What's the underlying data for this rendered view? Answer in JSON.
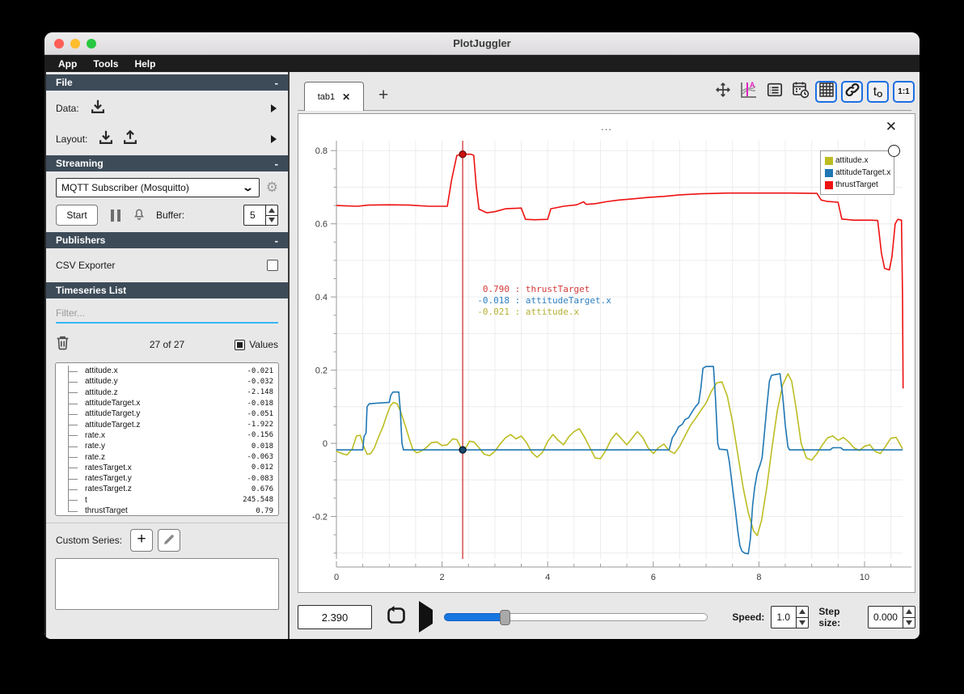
{
  "window": {
    "title": "PlotJuggler"
  },
  "menu": {
    "items": [
      "App",
      "Tools",
      "Help"
    ]
  },
  "sidebar": {
    "file": {
      "title": "File",
      "collapse": "-",
      "data_label": "Data:",
      "layout_label": "Layout:"
    },
    "streaming": {
      "title": "Streaming",
      "collapse": "-",
      "source_selected": "MQTT Subscriber (Mosquitto)",
      "start_label": "Start",
      "buffer_label": "Buffer:",
      "buffer_value": "5"
    },
    "publishers": {
      "title": "Publishers",
      "collapse": "-",
      "csv_label": "CSV Exporter"
    },
    "timeseries": {
      "title": "Timeseries List",
      "filter_placeholder": "Filter...",
      "count": "27 of 27",
      "values_label": "Values",
      "items": [
        {
          "name": "attitude.x",
          "value": "-0.021"
        },
        {
          "name": "attitude.y",
          "value": "-0.032"
        },
        {
          "name": "attitude.z",
          "value": "-2.148"
        },
        {
          "name": "attitudeTarget.x",
          "value": "-0.018"
        },
        {
          "name": "attitudeTarget.y",
          "value": "-0.051"
        },
        {
          "name": "attitudeTarget.z",
          "value": "-1.922"
        },
        {
          "name": "rate.x",
          "value": "-0.156"
        },
        {
          "name": "rate.y",
          "value": "0.018"
        },
        {
          "name": "rate.z",
          "value": "-0.063"
        },
        {
          "name": "ratesTarget.x",
          "value": "0.012"
        },
        {
          "name": "ratesTarget.y",
          "value": "-0.083"
        },
        {
          "name": "ratesTarget.z",
          "value": "0.676"
        },
        {
          "name": "t",
          "value": "245.548"
        },
        {
          "name": "thrustTarget",
          "value": "0.79"
        }
      ]
    },
    "custom_series_label": "Custom Series:",
    "add_label": "+"
  },
  "main": {
    "tabs": [
      {
        "label": "tab1"
      }
    ],
    "new_tab_label": "+",
    "toolbar": {
      "t_label": "t",
      "t_sub": "O",
      "ratio_label": "1:1",
      "buttons": [
        {
          "name": "pan-zoom",
          "active": false
        },
        {
          "name": "curve-tracker",
          "active": false
        },
        {
          "name": "list-view",
          "active": false
        },
        {
          "name": "datetime",
          "active": false
        },
        {
          "name": "grid-view",
          "active": true
        },
        {
          "name": "link-axes",
          "active": true
        },
        {
          "name": "time-offset",
          "active": true
        },
        {
          "name": "ratio-1-1",
          "active": true
        }
      ]
    }
  },
  "plot": {
    "title": "...",
    "legend": [
      {
        "label": "attitude.x",
        "color": "#bcbd22"
      },
      {
        "label": "attitudeTarget.x",
        "color": "#1f77b4"
      },
      {
        "label": "thrustTarget",
        "color": "#ee1111"
      }
    ],
    "tooltip": [
      {
        "value": "0.790",
        "label": "thrustTarget",
        "color": "#d43a3a"
      },
      {
        "value": "-0.018",
        "label": "attitudeTarget.x",
        "color": "#2d7fc1"
      },
      {
        "value": "-0.021",
        "label": "attitude.x",
        "color": "#b4b032"
      }
    ]
  },
  "playback": {
    "time": "2.390",
    "slider_percent": 23,
    "speed_label": "Speed:",
    "speed": "1.0",
    "step_label": "Step size:",
    "step": "0.000"
  },
  "chart_data": {
    "type": "line",
    "xlim": [
      0,
      10.72
    ],
    "ylim": [
      -0.316,
      0.827
    ],
    "xticks": {
      "values": [
        0,
        2,
        4,
        6,
        8,
        10
      ],
      "labels": [
        "0",
        "2",
        "4",
        "6",
        "8",
        "10"
      ]
    },
    "yticks": {
      "values": [
        -0.2,
        0,
        0.2,
        0.4,
        0.6,
        0.8
      ],
      "labels": [
        "-0.2",
        "0",
        "0.2",
        "0.4",
        "0.6",
        "0.8"
      ]
    },
    "grid": {
      "x_step": 0.5,
      "y_step": 0.1,
      "color": "#ececec"
    },
    "minor_ticks": {
      "x_step": 0.5,
      "y_step": 0.05
    },
    "tracker": {
      "x": 2.39,
      "color": "#cc2222",
      "markers": [
        {
          "x": 2.39,
          "y": 0.79,
          "fill": "#cc1111",
          "stroke": "#7a0c0c"
        },
        {
          "x": 2.39,
          "y": -0.018,
          "fill": "#17496e",
          "stroke": "#0a1e2e"
        }
      ]
    },
    "series": [
      {
        "name": "attitude.x",
        "color": "#bcbd22",
        "points": [
          [
            0,
            -0.021
          ],
          [
            0.1,
            -0.028
          ],
          [
            0.2,
            -0.032
          ],
          [
            0.3,
            -0.015
          ],
          [
            0.38,
            0.02
          ],
          [
            0.45,
            0.022
          ],
          [
            0.52,
            -0.01
          ],
          [
            0.58,
            -0.03
          ],
          [
            0.65,
            -0.028
          ],
          [
            0.72,
            -0.012
          ],
          [
            0.8,
            0.018
          ],
          [
            0.88,
            0.045
          ],
          [
            0.95,
            0.075
          ],
          [
            1.02,
            0.102
          ],
          [
            1.08,
            0.112
          ],
          [
            1.15,
            0.108
          ],
          [
            1.22,
            0.085
          ],
          [
            1.3,
            0.05
          ],
          [
            1.38,
            0.012
          ],
          [
            1.45,
            -0.018
          ],
          [
            1.52,
            -0.026
          ],
          [
            1.6,
            -0.022
          ],
          [
            1.7,
            -0.012
          ],
          [
            1.8,
            0.002
          ],
          [
            1.9,
            0.004
          ],
          [
            2.0,
            -0.006
          ],
          [
            2.1,
            -0.004
          ],
          [
            2.2,
            0.012
          ],
          [
            2.28,
            0.01
          ],
          [
            2.35,
            -0.01
          ],
          [
            2.39,
            -0.021
          ],
          [
            2.45,
            -0.012
          ],
          [
            2.52,
            0.006
          ],
          [
            2.6,
            0.004
          ],
          [
            2.7,
            -0.012
          ],
          [
            2.8,
            -0.03
          ],
          [
            2.9,
            -0.034
          ],
          [
            3.0,
            -0.022
          ],
          [
            3.1,
            -0.002
          ],
          [
            3.2,
            0.015
          ],
          [
            3.3,
            0.024
          ],
          [
            3.4,
            0.012
          ],
          [
            3.5,
            0.02
          ],
          [
            3.6,
            0.002
          ],
          [
            3.7,
            -0.025
          ],
          [
            3.8,
            -0.038
          ],
          [
            3.9,
            -0.025
          ],
          [
            4.0,
            0.005
          ],
          [
            4.1,
            0.024
          ],
          [
            4.2,
            0.008
          ],
          [
            4.3,
            -0.004
          ],
          [
            4.4,
            0.018
          ],
          [
            4.5,
            0.032
          ],
          [
            4.6,
            0.04
          ],
          [
            4.7,
            0.016
          ],
          [
            4.8,
            -0.012
          ],
          [
            4.9,
            -0.04
          ],
          [
            5.0,
            -0.042
          ],
          [
            5.1,
            -0.02
          ],
          [
            5.2,
            0.01
          ],
          [
            5.3,
            0.028
          ],
          [
            5.4,
            0.012
          ],
          [
            5.5,
            -0.004
          ],
          [
            5.6,
            0.014
          ],
          [
            5.7,
            0.032
          ],
          [
            5.8,
            0.016
          ],
          [
            5.9,
            -0.012
          ],
          [
            6.0,
            -0.028
          ],
          [
            6.1,
            -0.012
          ],
          [
            6.2,
            -0.002
          ],
          [
            6.3,
            -0.02
          ],
          [
            6.4,
            -0.028
          ],
          [
            6.5,
            -0.008
          ],
          [
            6.6,
            0.02
          ],
          [
            6.7,
            0.048
          ],
          [
            6.8,
            0.068
          ],
          [
            6.9,
            0.09
          ],
          [
            7.0,
            0.11
          ],
          [
            7.1,
            0.142
          ],
          [
            7.2,
            0.165
          ],
          [
            7.3,
            0.168
          ],
          [
            7.4,
            0.13
          ],
          [
            7.5,
            0.06
          ],
          [
            7.6,
            -0.03
          ],
          [
            7.7,
            -0.12
          ],
          [
            7.8,
            -0.19
          ],
          [
            7.9,
            -0.24
          ],
          [
            7.97,
            -0.252
          ],
          [
            8.05,
            -0.21
          ],
          [
            8.15,
            -0.12
          ],
          [
            8.25,
            -0.01
          ],
          [
            8.35,
            0.09
          ],
          [
            8.45,
            0.16
          ],
          [
            8.55,
            0.19
          ],
          [
            8.62,
            0.17
          ],
          [
            8.7,
            0.1
          ],
          [
            8.8,
            0.0
          ],
          [
            8.9,
            -0.04
          ],
          [
            9.0,
            -0.046
          ],
          [
            9.1,
            -0.028
          ],
          [
            9.2,
            -0.005
          ],
          [
            9.3,
            0.015
          ],
          [
            9.4,
            0.02
          ],
          [
            9.5,
            0.008
          ],
          [
            9.6,
            0.016
          ],
          [
            9.7,
            0.004
          ],
          [
            9.8,
            -0.012
          ],
          [
            9.9,
            -0.02
          ],
          [
            10.0,
            -0.008
          ],
          [
            10.1,
            -0.004
          ],
          [
            10.2,
            -0.022
          ],
          [
            10.3,
            -0.028
          ],
          [
            10.4,
            -0.008
          ],
          [
            10.5,
            0.014
          ],
          [
            10.6,
            0.016
          ],
          [
            10.68,
            -0.005
          ],
          [
            10.72,
            -0.015
          ]
        ]
      },
      {
        "name": "attitudeTarget.x",
        "color": "#1f77b4",
        "points": [
          [
            0,
            -0.018
          ],
          [
            0.5,
            -0.018
          ],
          [
            0.52,
            0.018
          ],
          [
            0.56,
            0.028
          ],
          [
            0.58,
            0.1
          ],
          [
            0.62,
            0.108
          ],
          [
            0.8,
            0.11
          ],
          [
            1.0,
            0.112
          ],
          [
            1.03,
            0.132
          ],
          [
            1.07,
            0.14
          ],
          [
            1.18,
            0.14
          ],
          [
            1.21,
            0.09
          ],
          [
            1.24,
            0.0
          ],
          [
            1.27,
            -0.018
          ],
          [
            3.0,
            -0.018
          ],
          [
            5.0,
            -0.018
          ],
          [
            6.3,
            -0.018
          ],
          [
            6.36,
            0.015
          ],
          [
            6.42,
            0.028
          ],
          [
            6.48,
            0.045
          ],
          [
            6.55,
            0.052
          ],
          [
            6.6,
            0.065
          ],
          [
            6.67,
            0.07
          ],
          [
            6.73,
            0.085
          ],
          [
            6.8,
            0.1
          ],
          [
            6.86,
            0.11
          ],
          [
            6.9,
            0.15
          ],
          [
            6.94,
            0.205
          ],
          [
            7.0,
            0.21
          ],
          [
            7.14,
            0.21
          ],
          [
            7.18,
            0.12
          ],
          [
            7.22,
            0.0
          ],
          [
            7.25,
            -0.016
          ],
          [
            7.4,
            -0.018
          ],
          [
            7.44,
            -0.05
          ],
          [
            7.5,
            -0.12
          ],
          [
            7.56,
            -0.19
          ],
          [
            7.6,
            -0.24
          ],
          [
            7.64,
            -0.28
          ],
          [
            7.68,
            -0.295
          ],
          [
            7.73,
            -0.3
          ],
          [
            7.8,
            -0.302
          ],
          [
            7.84,
            -0.26
          ],
          [
            7.88,
            -0.17
          ],
          [
            7.92,
            -0.12
          ],
          [
            7.97,
            -0.08
          ],
          [
            8.02,
            -0.06
          ],
          [
            8.06,
            -0.04
          ],
          [
            8.1,
            0.02
          ],
          [
            8.15,
            0.1
          ],
          [
            8.2,
            0.17
          ],
          [
            8.24,
            0.186
          ],
          [
            8.4,
            0.19
          ],
          [
            8.45,
            0.13
          ],
          [
            8.5,
            0.05
          ],
          [
            8.55,
            -0.01
          ],
          [
            8.58,
            -0.018
          ],
          [
            9.35,
            -0.018
          ],
          [
            9.4,
            -0.012
          ],
          [
            9.55,
            -0.012
          ],
          [
            9.6,
            -0.018
          ],
          [
            10.72,
            -0.018
          ]
        ]
      },
      {
        "name": "thrustTarget",
        "color": "#ee1111",
        "points": [
          [
            0,
            0.65
          ],
          [
            0.4,
            0.648
          ],
          [
            0.6,
            0.651
          ],
          [
            1.0,
            0.652
          ],
          [
            1.4,
            0.651
          ],
          [
            1.75,
            0.648
          ],
          [
            2.1,
            0.648
          ],
          [
            2.18,
            0.72
          ],
          [
            2.28,
            0.787
          ],
          [
            2.39,
            0.79
          ],
          [
            2.55,
            0.79
          ],
          [
            2.6,
            0.787
          ],
          [
            2.65,
            0.7
          ],
          [
            2.7,
            0.64
          ],
          [
            2.85,
            0.63
          ],
          [
            3.0,
            0.633
          ],
          [
            3.2,
            0.641
          ],
          [
            3.5,
            0.643
          ],
          [
            3.58,
            0.612
          ],
          [
            3.75,
            0.611
          ],
          [
            4.0,
            0.612
          ],
          [
            4.06,
            0.641
          ],
          [
            4.3,
            0.648
          ],
          [
            4.55,
            0.652
          ],
          [
            4.68,
            0.66
          ],
          [
            4.73,
            0.653
          ],
          [
            4.9,
            0.655
          ],
          [
            5.1,
            0.66
          ],
          [
            5.35,
            0.665
          ],
          [
            5.6,
            0.668
          ],
          [
            5.9,
            0.672
          ],
          [
            6.2,
            0.675
          ],
          [
            6.5,
            0.679
          ],
          [
            6.9,
            0.682
          ],
          [
            7.4,
            0.684
          ],
          [
            8.0,
            0.684
          ],
          [
            8.6,
            0.684
          ],
          [
            9.1,
            0.683
          ],
          [
            9.18,
            0.665
          ],
          [
            9.3,
            0.661
          ],
          [
            9.5,
            0.659
          ],
          [
            9.57,
            0.613
          ],
          [
            9.8,
            0.61
          ],
          [
            10.1,
            0.61
          ],
          [
            10.25,
            0.609
          ],
          [
            10.32,
            0.52
          ],
          [
            10.38,
            0.478
          ],
          [
            10.47,
            0.474
          ],
          [
            10.52,
            0.51
          ],
          [
            10.58,
            0.6
          ],
          [
            10.63,
            0.612
          ],
          [
            10.7,
            0.61
          ],
          [
            10.72,
            0.4
          ],
          [
            10.73,
            0.15
          ]
        ]
      }
    ]
  }
}
